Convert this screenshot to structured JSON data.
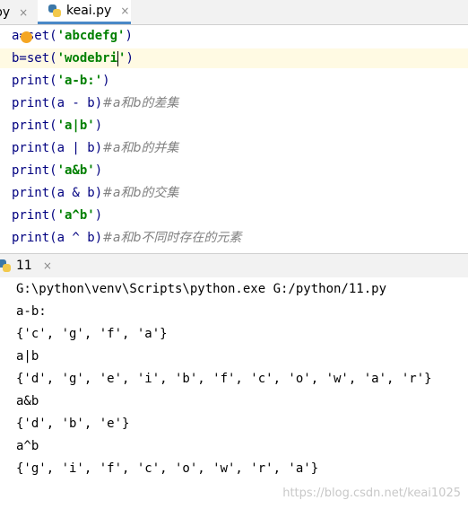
{
  "tabs": [
    {
      "label": "py",
      "close": "×"
    },
    {
      "label": "keai.py",
      "close": "×"
    }
  ],
  "code": [
    {
      "parts": [
        {
          "t": "a",
          "c": ""
        },
        {
          "t": "=set(",
          "c": ""
        },
        {
          "t": "'abcdefg'",
          "c": "str"
        },
        {
          "t": ")",
          "c": ""
        }
      ]
    },
    {
      "parts": [
        {
          "t": "b=set(",
          "c": ""
        },
        {
          "t": "'wodebri",
          "c": "str"
        },
        {
          "t": "CARET",
          "c": "caret"
        },
        {
          "t": "'",
          "c": "str"
        },
        {
          "t": ")",
          "c": ""
        }
      ]
    },
    {
      "parts": [
        {
          "t": "print(",
          "c": ""
        },
        {
          "t": "'a-b:'",
          "c": "str"
        },
        {
          "t": ")",
          "c": ""
        }
      ]
    },
    {
      "parts": [
        {
          "t": "print(a - b)",
          "c": ""
        },
        {
          "t": "#a和b的差集",
          "c": "cm"
        }
      ]
    },
    {
      "parts": [
        {
          "t": "print(",
          "c": ""
        },
        {
          "t": "'a|b'",
          "c": "str"
        },
        {
          "t": ")",
          "c": ""
        }
      ]
    },
    {
      "parts": [
        {
          "t": "print(a | b)",
          "c": ""
        },
        {
          "t": "#a和b的并集",
          "c": "cm"
        }
      ]
    },
    {
      "parts": [
        {
          "t": "print(",
          "c": ""
        },
        {
          "t": "'a&b'",
          "c": "str"
        },
        {
          "t": ")",
          "c": ""
        }
      ]
    },
    {
      "parts": [
        {
          "t": "print(a & b)",
          "c": ""
        },
        {
          "t": "#a和b的交集",
          "c": "cm"
        }
      ]
    },
    {
      "parts": [
        {
          "t": "print(",
          "c": ""
        },
        {
          "t": "'a^b'",
          "c": "str"
        },
        {
          "t": ")",
          "c": ""
        }
      ]
    },
    {
      "parts": [
        {
          "t": "print(a ^ b)",
          "c": ""
        },
        {
          "t": "#a和b不同时存在的元素",
          "c": "cm"
        }
      ]
    }
  ],
  "run": {
    "tab_label": "11",
    "close": "×"
  },
  "console": [
    "G:\\python\\venv\\Scripts\\python.exe G:/python/11.py",
    "a-b:",
    "{'c', 'g', 'f', 'a'}",
    "a|b",
    "{'d', 'g', 'e', 'i', 'b', 'f', 'c', 'o', 'w', 'a', 'r'}",
    "a&b",
    "{'d', 'b', 'e'}",
    "a^b",
    "{'g', 'i', 'f', 'c', 'o', 'w', 'r', 'a'}"
  ],
  "watermark": "https://blog.csdn.net/keai1025",
  "colors": {
    "string": "#008000",
    "comment": "#808080",
    "keyword": "#000080",
    "tab_accent": "#4a88c7"
  }
}
